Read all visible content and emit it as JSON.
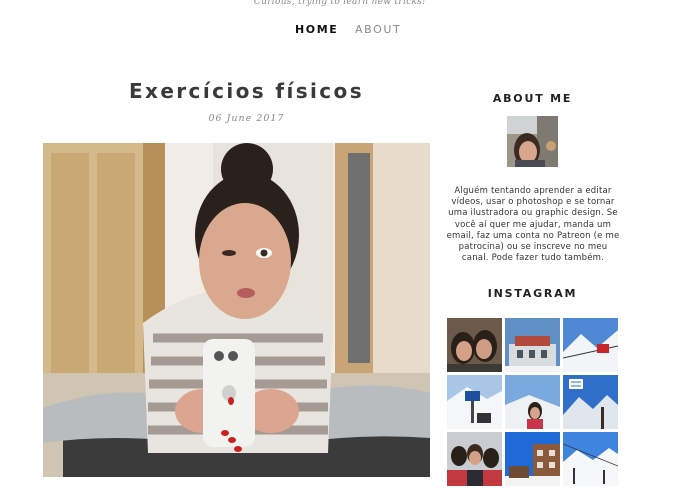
{
  "header": {
    "tagline": "Curious, trying to learn new tricks!"
  },
  "nav": {
    "home": "HOME",
    "about": "ABOUT"
  },
  "post": {
    "title": "Exercícios físicos",
    "date": "06 June 2017",
    "image_subject": "mirror-selfie-stretching-photo"
  },
  "sidebar": {
    "about_title": "ABOUT ME",
    "about_text": "Alguém tentando aprender a editar vídeos, usar o photoshop e se tornar uma ilustradora ou graphic design. Se você aí quer me ajudar, manda um email, faz uma conta no Patreon (e me patrocina) ou se inscreve no meu canal. Pode fazer tudo também.",
    "instagram_title": "INSTAGRAM",
    "instagram_photos": [
      {
        "subject": "selfie-couple"
      },
      {
        "subject": "station-building-blue-sky"
      },
      {
        "subject": "snowy-mountains-cable-car"
      },
      {
        "subject": "ski-slope-sign"
      },
      {
        "subject": "snow-portrait"
      },
      {
        "subject": "alpine-valley-flag"
      },
      {
        "subject": "group-selfie-snow"
      },
      {
        "subject": "village-street-sky"
      },
      {
        "subject": "ski-lift-mountain"
      }
    ]
  },
  "colors": {
    "nav_active": "#111111",
    "nav_inactive": "#8a8a8a",
    "title": "#3a3a3a"
  }
}
